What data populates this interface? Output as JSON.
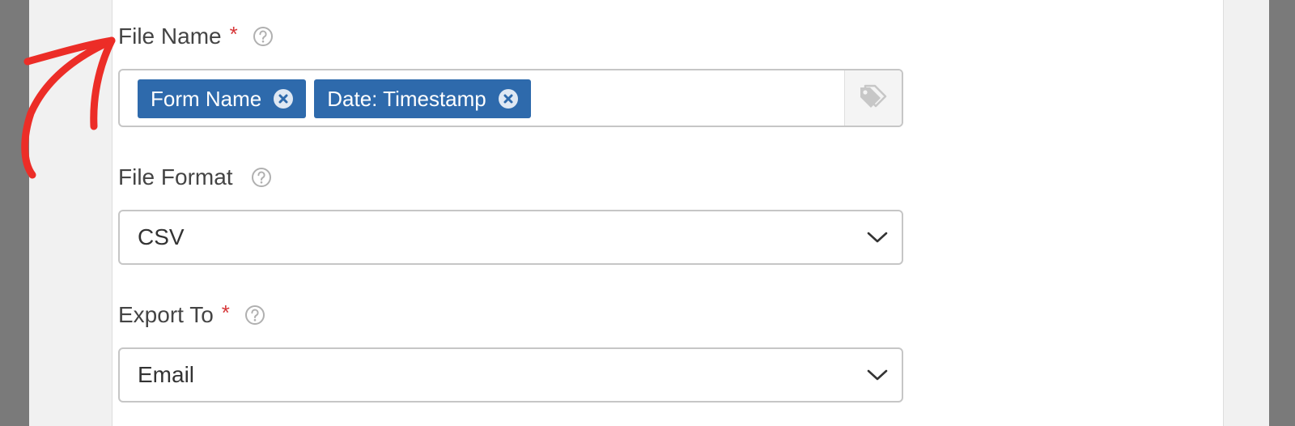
{
  "form": {
    "file_name": {
      "label": "File Name",
      "required_mark": "*",
      "help_icon": "question-circle-icon",
      "tags": [
        {
          "label": "Form Name",
          "remove_icon": "close-circle-icon"
        },
        {
          "label": "Date: Timestamp",
          "remove_icon": "close-circle-icon"
        }
      ],
      "smart_tag_icon": "tags-icon"
    },
    "file_format": {
      "label": "File Format",
      "help_icon": "question-circle-icon",
      "value": "CSV",
      "dropdown_icon": "chevron-down-icon"
    },
    "export_to": {
      "label": "Export To",
      "required_mark": "*",
      "help_icon": "question-circle-icon",
      "value": "Email",
      "dropdown_icon": "chevron-down-icon"
    }
  },
  "annotation": {
    "icon": "hand-drawn-arrow-icon",
    "color": "#ec2d27"
  },
  "colors": {
    "tag_bg": "#2e6aac",
    "required": "#d63638",
    "label": "#444444"
  }
}
